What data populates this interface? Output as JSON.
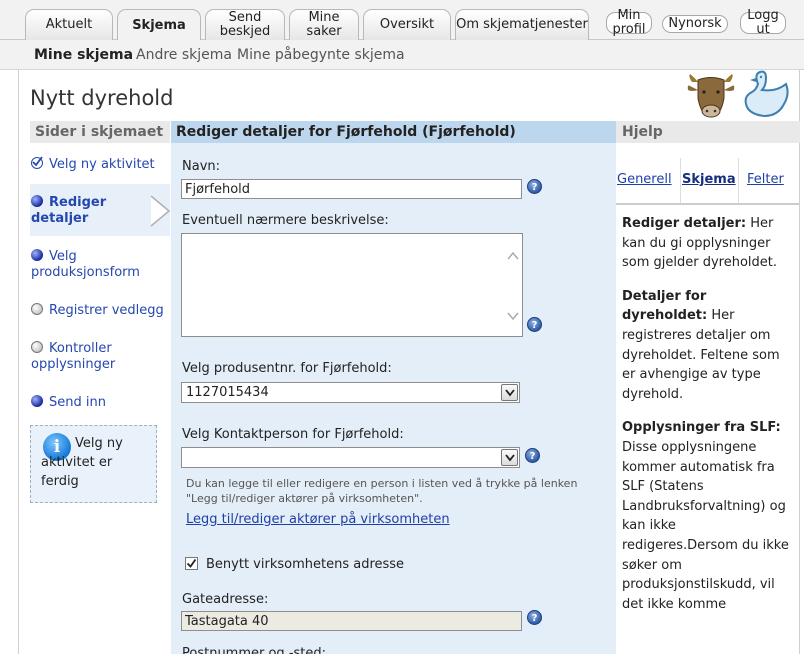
{
  "topnav": {
    "tabs": [
      "Aktuelt",
      "Skjema",
      "Send beskjed",
      "Mine saker",
      "Oversikt",
      "Om skjematjenester"
    ],
    "active_tab": "Skjema",
    "min_profil": "Min profil",
    "nynorsk": "Nynorsk",
    "logg_ut": "Logg ut"
  },
  "subnav": {
    "items": [
      "Mine skjema",
      "Andre skjema",
      "Mine påbegynte skjema"
    ]
  },
  "page": {
    "title": "Nytt dyrehold"
  },
  "left": {
    "header": "Sider i skjemaet",
    "items": [
      {
        "label": "Velg ny aktivitet",
        "status": "done"
      },
      {
        "label": "Rediger detaljer",
        "status": "current"
      },
      {
        "label": "Velg produksjonsform",
        "status": "todo"
      },
      {
        "label": "Registrer vedlegg",
        "status": "grey"
      },
      {
        "label": "Kontroller opplysninger",
        "status": "grey"
      },
      {
        "label": "Send inn",
        "status": "todo"
      }
    ],
    "info": "Velg ny aktivitet er ferdig"
  },
  "center": {
    "header": "Rediger detaljer for Fjørfehold (Fjørfehold)",
    "navn_label": "Navn:",
    "navn_value": "Fjørfehold",
    "beskrivelse_label": "Eventuell nærmere beskrivelse:",
    "beskrivelse_value": "",
    "produsent_label": "Velg produsentnr. for Fjørfehold:",
    "produsent_value": "1127015434",
    "kontakt_label": "Velg Kontaktperson for Fjørfehold:",
    "kontakt_value": "",
    "note": "Du kan legge til eller redigere en person i listen ved å trykke på lenken \"Legg til/rediger aktører på virksomheten\".",
    "link": "Legg til/rediger aktører på virksomheten",
    "checkbox_label": "Benytt virksomhetens adresse",
    "checkbox_checked": true,
    "gate_label": "Gateadresse:",
    "gate_value": "Tastagata 40",
    "post_label": "Postnummer og -sted:"
  },
  "right": {
    "header": "Hjelp",
    "tabs": [
      "Generell",
      "Skjema",
      "Felter"
    ],
    "active_tab": "Skjema",
    "p1_bold": "Rediger detaljer:",
    "p1_text": " Her kan du gi opplysninger som gjelder dyreholdet.",
    "p2_bold": "Detaljer for dyreholdet:",
    "p2_text": " Her registreres detaljer om dyreholdet. Feltene som er avhengige av type dyrehold.",
    "p3_bold": "Opplysninger fra SLF:",
    "p3_text": " Disse opplysningene kommer automatisk fra SLF (Statens Landbruksforvaltning) og kan ikke redigeres.Dersom du ikke søker om produksjonstilskudd, vil det ikke komme"
  }
}
